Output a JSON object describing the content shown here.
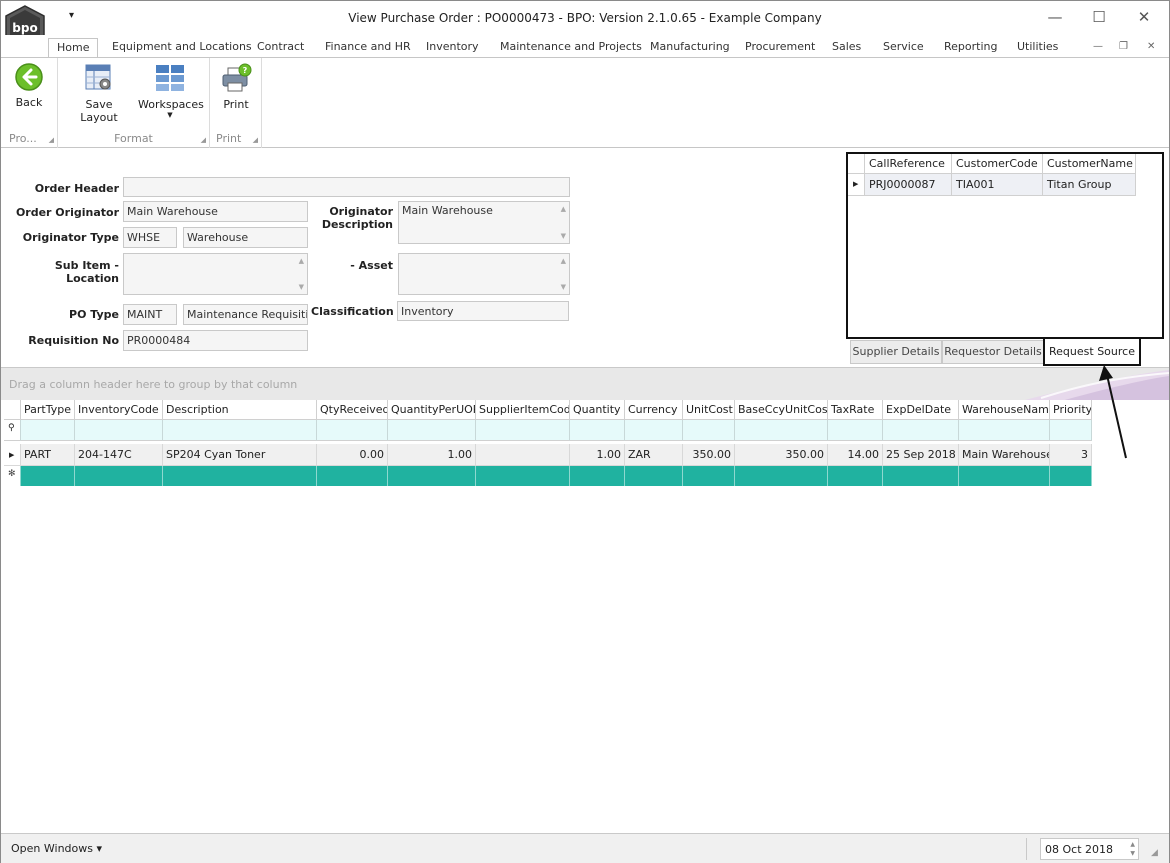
{
  "window": {
    "title": "View Purchase Order : PO0000473 - BPO: Version 2.1.0.65 - Example Company",
    "logo_text": "bpo",
    "qat_glyph": "▾",
    "controls": {
      "minimize": "—",
      "maximize": "☐",
      "close": "✕"
    },
    "mdi_controls": {
      "minimize": "—",
      "restore": "❐",
      "close": "✕"
    }
  },
  "ribbon_tabs": [
    "Home",
    "Equipment and Locations",
    "Contract",
    "Finance and HR",
    "Inventory",
    "Maintenance and Projects",
    "Manufacturing",
    "Procurement",
    "Sales",
    "Service",
    "Reporting",
    "Utilities"
  ],
  "ribbon": {
    "groups": [
      {
        "label": "Pro...",
        "buttons": [
          {
            "label": "Back",
            "icon": "back-arrow-icon"
          }
        ]
      },
      {
        "label": "Format",
        "buttons": [
          {
            "label": "Save Layout",
            "icon": "save-layout-icon"
          },
          {
            "label": "Workspaces",
            "icon": "workspaces-icon"
          }
        ]
      },
      {
        "label": "Print",
        "buttons": [
          {
            "label": "Print",
            "icon": "printer-icon"
          }
        ]
      }
    ]
  },
  "form": {
    "order_header": {
      "label": "Order Header",
      "value": ""
    },
    "order_originator": {
      "label": "Order Originator",
      "value": "Main Warehouse"
    },
    "originator_type": {
      "label": "Originator Type",
      "code": "WHSE",
      "value": "Warehouse"
    },
    "sub_item_location": {
      "label": "Sub Item - Location",
      "value": ""
    },
    "po_type": {
      "label": "PO Type",
      "code": "MAINT",
      "value": "Maintenance Requisition"
    },
    "requisition_no": {
      "label": "Requisition No",
      "value": "PR0000484"
    },
    "originator_description": {
      "label_line1": "Originator",
      "label_line2": "Description",
      "value": "Main Warehouse"
    },
    "asset": {
      "label": "- Asset",
      "value": ""
    },
    "classification": {
      "label": "Classification",
      "value": "Inventory"
    }
  },
  "request_source_grid": {
    "columns": [
      "CallReference",
      "CustomerCode",
      "CustomerName"
    ],
    "rows": [
      [
        "PRJ0000087",
        "TIA001",
        "Titan Group"
      ]
    ]
  },
  "detail_tabs": [
    "Supplier Details",
    "Requestor Details",
    "Request Source"
  ],
  "detail_tabs_active": "Request Source",
  "group_panel_hint": "Drag a column header here to group by that column",
  "lines_grid": {
    "columns": [
      "PartType",
      "InventoryCode",
      "Description",
      "QtyReceived",
      "QuantityPerUOP",
      "SupplierItemCode",
      "Quantity",
      "Currency",
      "UnitCost",
      "BaseCcyUnitCost",
      "TaxRate",
      "ExpDelDate",
      "WarehouseName",
      "Priority"
    ],
    "rows": [
      [
        "PART",
        "204-147C",
        "SP204 Cyan Toner",
        "0.00",
        "1.00",
        "",
        "1.00",
        "ZAR",
        "350.00",
        "350.00",
        "14.00",
        "25 Sep 2018",
        "Main Warehouse",
        "3"
      ]
    ]
  },
  "statusbar": {
    "open_windows": "Open Windows ▾",
    "date": "08 Oct 2018"
  },
  "colors": {
    "new_row": "#20b2a0",
    "filter_row": "#e6fafa",
    "accent": "#2b579a"
  }
}
